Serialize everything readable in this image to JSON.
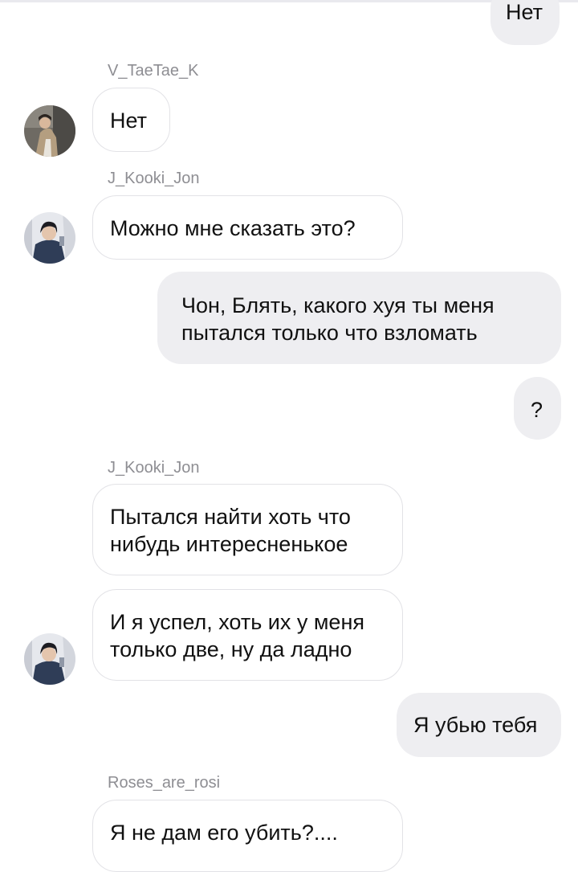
{
  "messages": [
    {
      "direction": "outgoing",
      "text": "Нет"
    },
    {
      "direction": "incoming",
      "sender": "V_TaeTae_K",
      "text": "Нет"
    },
    {
      "direction": "incoming",
      "sender": "J_Kooki_Jon",
      "text": "Можно мне сказать это?"
    },
    {
      "direction": "outgoing",
      "text": "Чон, Блять, какого хуя ты меня пытался только что взломать"
    },
    {
      "direction": "outgoing",
      "text": "?"
    },
    {
      "direction": "incoming",
      "sender": "J_Kooki_Jon",
      "text": "Пытался найти хоть что нибудь интересненькое"
    },
    {
      "direction": "incoming",
      "text": "И я успел, хоть их у меня только две, ну да ладно"
    },
    {
      "direction": "outgoing",
      "text": "Я убью тебя"
    },
    {
      "direction": "incoming",
      "sender": "Roses_are_rosi",
      "text": "Я не дам его убить?...."
    }
  ],
  "colors": {
    "outgoing_bubble": "#eeeef1",
    "incoming_border": "#e2e2e6",
    "username": "#8e8e93"
  }
}
